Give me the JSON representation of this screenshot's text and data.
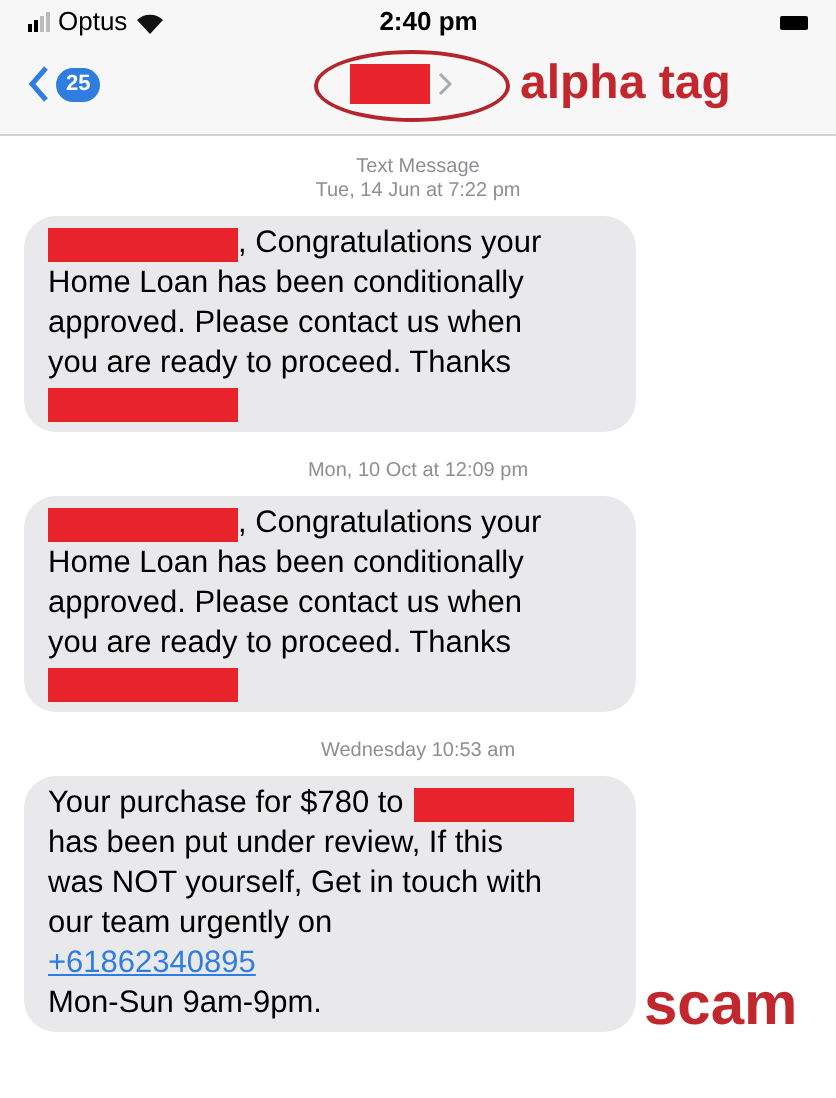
{
  "status_bar": {
    "carrier": "Optus",
    "time": "2:40 pm"
  },
  "nav": {
    "back_badge": "25",
    "contact_redacted": true
  },
  "annotations": [
    {
      "kind": "alpha",
      "text": "alpha tag"
    },
    {
      "kind": "scam",
      "text": "scam"
    }
  ],
  "messages": [
    {
      "header": [
        "Text Message",
        "Tue, 14 Jun at 7:22 pm"
      ],
      "lines": [
        [
          {
            "kind": "redaction"
          },
          {
            "kind": "text",
            "text": ", Congratulations your"
          }
        ],
        [
          {
            "kind": "text",
            "text": "Home Loan has been conditionally"
          }
        ],
        [
          {
            "kind": "text",
            "text": "approved. Please contact us when"
          }
        ],
        [
          {
            "kind": "text",
            "text": "you are ready to proceed. Thanks"
          }
        ],
        [
          {
            "kind": "redaction"
          }
        ]
      ]
    },
    {
      "header": [
        "Mon, 10 Oct at 12:09 pm"
      ],
      "lines": [
        [
          {
            "kind": "redaction"
          },
          {
            "kind": "text",
            "text": ", Congratulations your"
          }
        ],
        [
          {
            "kind": "text",
            "text": "Home Loan has been conditionally"
          }
        ],
        [
          {
            "kind": "text",
            "text": "approved. Please contact us when"
          }
        ],
        [
          {
            "kind": "text",
            "text": "you are ready to proceed. Thanks"
          }
        ],
        [
          {
            "kind": "redaction"
          }
        ]
      ]
    },
    {
      "header": [
        "Wednesday 10:53 am"
      ],
      "lines": [
        [
          {
            "kind": "text",
            "text": "Your purchase for $780 to"
          },
          {
            "kind": "redaction"
          }
        ],
        [
          {
            "kind": "text",
            "text": "has been put under review, If this"
          }
        ],
        [
          {
            "kind": "text",
            "text": "was NOT yourself, Get in touch with"
          }
        ],
        [
          {
            "kind": "text",
            "text": "our team urgently on"
          }
        ],
        [
          {
            "kind": "link",
            "text": "+61862340895"
          }
        ],
        [
          {
            "kind": "text",
            "text": "Mon-Sun 9am-9pm."
          }
        ]
      ]
    }
  ]
}
